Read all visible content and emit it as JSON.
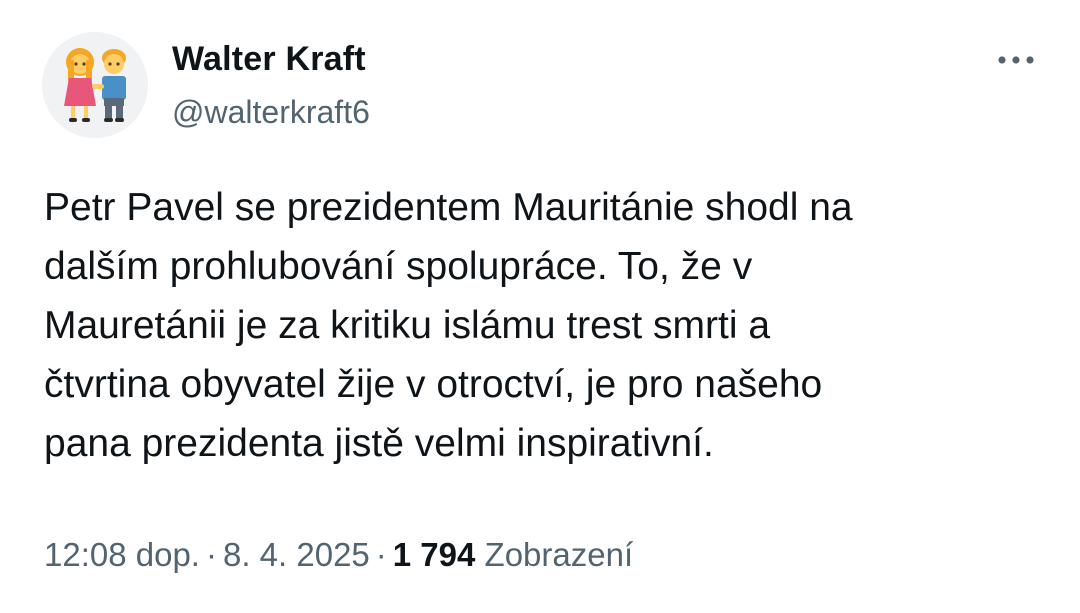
{
  "author": {
    "name": "Walter Kraft",
    "handle": "@walterkraft6",
    "avatar_icon": "couple-holding-hands-emoji"
  },
  "tweet": {
    "lines": [
      "Petr Pavel se prezidentem Mauritánie shodl na",
      "dalším prohlubování spolupráce. To, že v",
      "Mauretánii je za kritiku islámu trest smrti a",
      "čtvrtina obyvatel žije v otroctví, je pro našeho",
      "pana prezidenta jistě velmi inspirativní."
    ]
  },
  "meta": {
    "time": "12:08 dop.",
    "separator": "·",
    "date": "8. 4. 2025",
    "views_count": "1 794",
    "views_label": "Zobrazení"
  },
  "icons": {
    "more": "more-options-icon"
  },
  "colors": {
    "text_primary": "#0f1419",
    "text_secondary": "#536471",
    "background": "#ffffff"
  }
}
